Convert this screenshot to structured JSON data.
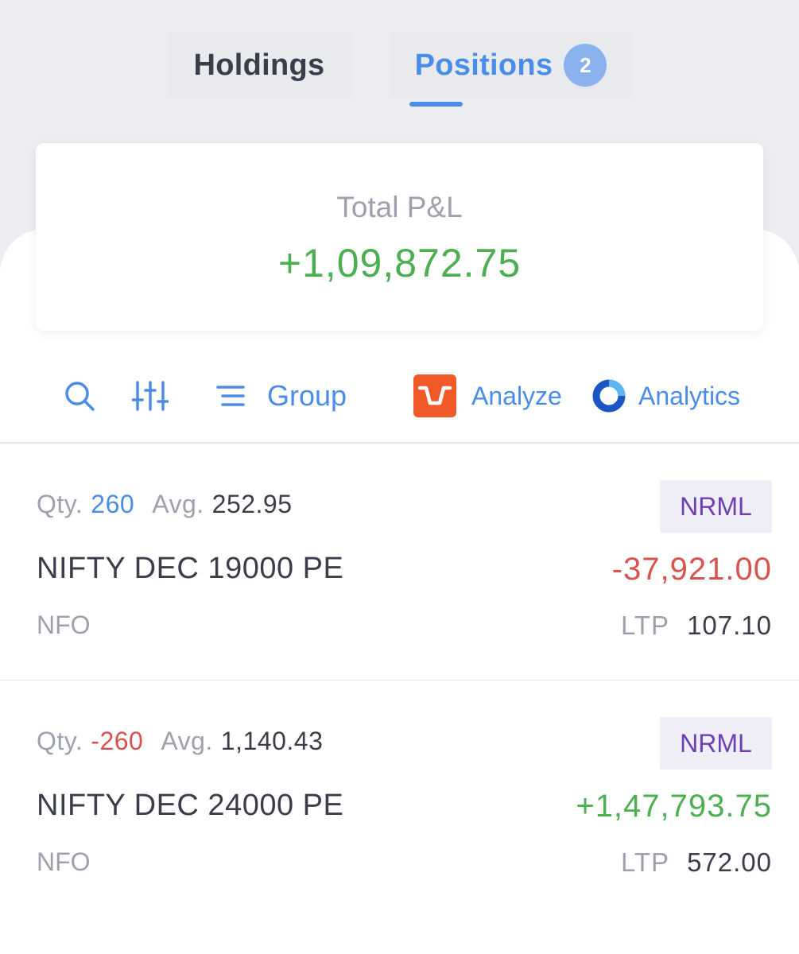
{
  "tabs": {
    "holdings": "Holdings",
    "positions": "Positions",
    "positions_count": "2"
  },
  "summary": {
    "label": "Total P&L",
    "value": "+1,09,872.75"
  },
  "toolbar": {
    "group_label": "Group",
    "analyze_label": "Analyze",
    "analytics_label": "Analytics"
  },
  "positions": [
    {
      "qty_label": "Qty.",
      "qty": "260",
      "avg_label": "Avg.",
      "avg": "252.95",
      "product": "NRML",
      "symbol": "NIFTY DEC 19000 PE",
      "pnl": "-37,921.00",
      "exchange": "NFO",
      "ltp_label": "LTP",
      "ltp": "107.10"
    },
    {
      "qty_label": "Qty.",
      "qty": "-260",
      "avg_label": "Avg.",
      "avg": "1,140.43",
      "product": "NRML",
      "symbol": "NIFTY DEC 24000 PE",
      "pnl": "+1,47,793.75",
      "exchange": "NFO",
      "ltp_label": "LTP",
      "ltp": "572.00"
    }
  ],
  "colors": {
    "accent": "#4a8de9",
    "profit": "#4caf50",
    "loss": "#d9534f",
    "product_tag": "#6b3fb3",
    "analyze_brand": "#f05a28",
    "analytics_brand": "#1a56c4"
  }
}
